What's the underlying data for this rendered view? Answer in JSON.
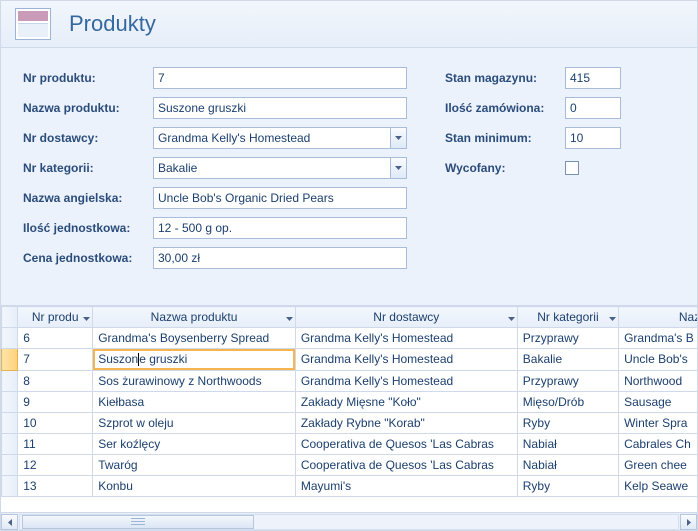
{
  "header": {
    "title": "Produkty"
  },
  "form": {
    "fields": {
      "nr_produktu": {
        "label": "Nr produktu:",
        "value": "7"
      },
      "nazwa_produktu": {
        "label": "Nazwa produktu:",
        "value": "Suszone gruszki"
      },
      "nr_dostawcy": {
        "label": "Nr dostawcy:",
        "value": "Grandma Kelly's Homestead"
      },
      "nr_kategorii": {
        "label": "Nr kategorii:",
        "value": "Bakalie"
      },
      "nazwa_angielska": {
        "label": "Nazwa angielska:",
        "value": "Uncle Bob's Organic Dried Pears"
      },
      "ilosc_jednostkowa": {
        "label": "Ilość jednostkowa:",
        "value": "12 - 500 g op."
      },
      "cena_jednostkowa": {
        "label": "Cena jednostkowa:",
        "value": "30,00 zł"
      },
      "stan_magazynu": {
        "label": "Stan magazynu:",
        "value": "415"
      },
      "ilosc_zamowiona": {
        "label": "Ilość zamówiona:",
        "value": "0"
      },
      "stan_minimum": {
        "label": "Stan minimum:",
        "value": "10"
      },
      "wycofany": {
        "label": "Wycofany:",
        "checked": false
      }
    }
  },
  "grid": {
    "columns": [
      "Nr produ",
      "Nazwa produktu",
      "Nr dostawcy",
      "Nr kategorii",
      "Naz"
    ],
    "selected_row_index": 1,
    "editing_cell": {
      "row": 1,
      "col": 1,
      "text_before": "Suszon",
      "text_after": "e gruszki"
    },
    "rows": [
      {
        "nr": "6",
        "nazwa": "Grandma's Boysenberry Spread",
        "dostawca": "Grandma Kelly's Homestead",
        "kategoria": "Przyprawy",
        "eng": "Grandma's B"
      },
      {
        "nr": "7",
        "nazwa": "Suszone gruszki",
        "dostawca": "Grandma Kelly's Homestead",
        "kategoria": "Bakalie",
        "eng": "Uncle Bob's"
      },
      {
        "nr": "8",
        "nazwa": "Sos żurawinowy z Northwoods",
        "dostawca": "Grandma Kelly's Homestead",
        "kategoria": "Przyprawy",
        "eng": "Northwood"
      },
      {
        "nr": "9",
        "nazwa": "Kiełbasa",
        "dostawca": "Zakłady Mięsne \"Koło\"",
        "kategoria": "Mięso/Drób",
        "eng": "Sausage"
      },
      {
        "nr": "10",
        "nazwa": "Szprot w oleju",
        "dostawca": "Zakłady Rybne \"Korab\"",
        "kategoria": "Ryby",
        "eng": "Winter Spra"
      },
      {
        "nr": "11",
        "nazwa": "Ser koźlęcy",
        "dostawca": "Cooperativa de Quesos 'Las Cabras",
        "kategoria": "Nabiał",
        "eng": "Cabrales Ch"
      },
      {
        "nr": "12",
        "nazwa": "Twaróg",
        "dostawca": "Cooperativa de Quesos 'Las Cabras",
        "kategoria": "Nabiał",
        "eng": "Green chee"
      },
      {
        "nr": "13",
        "nazwa": "Konbu",
        "dostawca": "Mayumi's",
        "kategoria": "Ryby",
        "eng": "Kelp Seawe"
      }
    ]
  }
}
